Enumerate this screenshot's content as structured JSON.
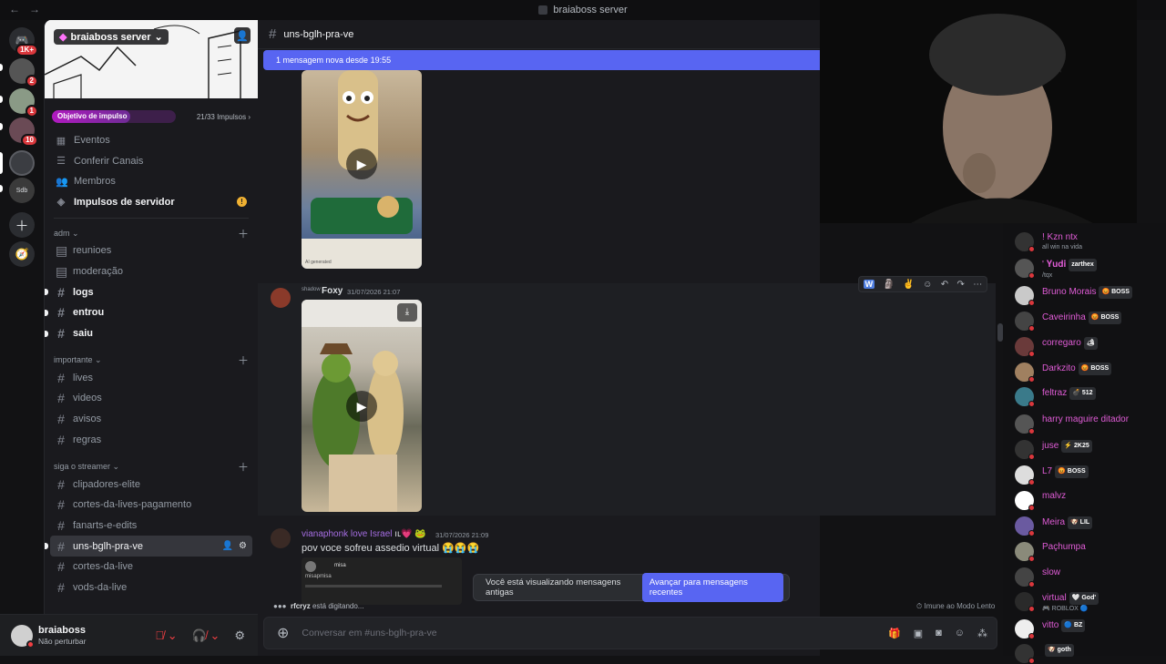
{
  "titlebar": {
    "title": "braiaboss server"
  },
  "rail": {
    "badges": [
      "1K+",
      "2",
      "1",
      "10"
    ],
    "sdb": "Sdb"
  },
  "server": {
    "name": "braiaboss server",
    "boost_goal_label": "Objetivo de impulso",
    "boost_progress_text": "21/33 Impulsos",
    "boost_fraction": 0.636
  },
  "menu": [
    {
      "label": "Eventos",
      "icon": "calendar-icon"
    },
    {
      "label": "Conferir Canais",
      "icon": "browse-channels-icon"
    },
    {
      "label": "Membros",
      "icon": "members-icon"
    },
    {
      "label": "Impulsos de servidor",
      "icon": "boost-icon"
    }
  ],
  "categories": {
    "adm": {
      "label": "adm",
      "channels": [
        "reunioes",
        "moderação",
        "logs",
        "entrou",
        "saiu"
      ]
    },
    "importante": {
      "label": "importante",
      "channels": [
        "lives",
        "videos",
        "avisos",
        "regras"
      ]
    },
    "streamer": {
      "label": "siga o streamer",
      "channels": [
        "clipadores-elite",
        "cortes-da-lives-pagamento",
        "fanarts-e-edits",
        "uns-bglh-pra-ve",
        "cortes-da-live",
        "vods-da-live"
      ]
    }
  },
  "user": {
    "name": "braiaboss",
    "status": "Não perturbar"
  },
  "chat": {
    "channel": "uns-bglh-pra-ve",
    "new_messages": "1 mensagem nova desde 19:55",
    "msg1": {
      "author": "Foxy",
      "prefix": "shadow",
      "time": "31/07/2026 21:07"
    },
    "msg2": {
      "author": "vianaphonk love Israel",
      "suffix": "ıʟ💗 🐸",
      "time": "31/07/2026 21:09",
      "text": "pov voce sofreu assedio virtual 😭😭😭"
    },
    "embed_name": "misa",
    "embed_user": "misapmisa",
    "old_msgs_text": "Você está visualizando mensagens antigas",
    "jump_button": "Avançar para mensagens recentes",
    "typing_user": "rfcryz",
    "typing_text": "está digitando...",
    "slow_mode": "Imune ao Modo Lento",
    "placeholder": "Conversar em #uns-bglh-pra-ve",
    "ai_label": "AI generated"
  },
  "stream_chat": [
    {
      "name": "! Kzn ntx",
      "sub": "all win na vida",
      "color": "#e05cd6"
    },
    {
      "name": "' 𝐘𝐮𝐝𝐢",
      "badge": "zarthex",
      "sub": "/tqx",
      "color": "#e05cd6"
    },
    {
      "name": "Bruno Morais",
      "badge": "😡 BOSS",
      "color": "#e05cd6"
    },
    {
      "name": "Caveirinha",
      "badge": "😡 BOSS",
      "color": "#e05cd6"
    },
    {
      "name": "corregaro",
      "badge": "🏕",
      "color": "#e05cd6"
    },
    {
      "name": "Darkzito",
      "badge": "😡 BOSS",
      "color": "#e05cd6"
    },
    {
      "name": "feltraz",
      "badge": "💣 512",
      "color": "#e05cd6"
    },
    {
      "name": "harry maguire ditador",
      "color": "#e05cd6"
    },
    {
      "name": "juse",
      "badge": "⚡ 2K25",
      "color": "#e05cd6"
    },
    {
      "name": "L7",
      "badge": "😡 BOSS",
      "color": "#e05cd6"
    },
    {
      "name": "malvz",
      "color": "#e05cd6"
    },
    {
      "name": "Meira",
      "badge": "🐶 LIL",
      "color": "#e05cd6"
    },
    {
      "name": "Paçhumpa",
      "color": "#e05cd6"
    },
    {
      "name": "slow",
      "color": "#e05cd6"
    },
    {
      "name": "virtual",
      "badge": "🤍 God'",
      "sub": "🎮 ROBLOX 🔵",
      "color": "#e05cd6"
    },
    {
      "name": "vitto",
      "badge": "🔵 BZ",
      "color": "#e05cd6"
    },
    {
      "name": "",
      "badge": "🐶 goth",
      "color": "#e05cd6"
    }
  ]
}
